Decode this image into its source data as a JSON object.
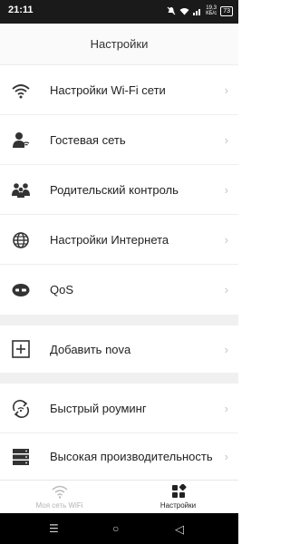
{
  "status_bar": {
    "time": "21:11",
    "speed_value": "19,3",
    "speed_unit": "КБ/с",
    "battery": "73"
  },
  "header": {
    "title": "Настройки"
  },
  "menu": [
    {
      "label": "Настройки Wi-Fi сети",
      "icon": "wifi-icon"
    },
    {
      "label": "Гостевая сеть",
      "icon": "guest-user-icon"
    },
    {
      "label": "Родительский контроль",
      "icon": "parental-control-icon"
    },
    {
      "label": "Настройки Интернета",
      "icon": "globe-icon"
    },
    {
      "label": "QoS",
      "icon": "qos-icon"
    }
  ],
  "menu2": [
    {
      "label": "Добавить nova",
      "icon": "add-box-icon"
    }
  ],
  "menu3": [
    {
      "label": "Быстрый роуминг",
      "icon": "roaming-icon"
    },
    {
      "label": "Высокая производительность",
      "icon": "server-icon"
    }
  ],
  "tabbar": {
    "tabs": [
      {
        "label": "Моя сеть WiFi",
        "icon": "wifi-tab-icon",
        "active": false
      },
      {
        "label": "Настройки",
        "icon": "settings-grid-icon",
        "active": true
      }
    ]
  },
  "colors": {
    "background": "#ffffff",
    "separator": "#f0f0f0",
    "text": "#222222",
    "chevron": "#c4c4c4"
  }
}
